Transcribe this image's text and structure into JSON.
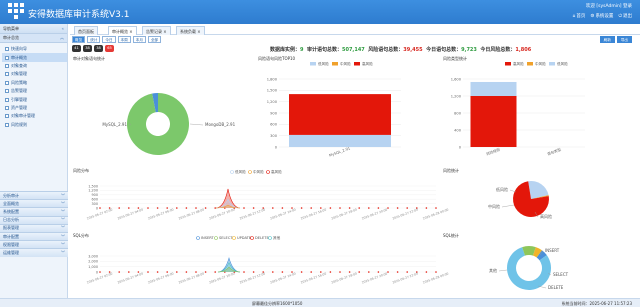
{
  "app": {
    "title": "安得数据库审计系统V3.1"
  },
  "header": {
    "welcome": "欢迎 [sysAdmin] 登录",
    "actions": [
      {
        "label": "首页",
        "icon": "home-icon"
      },
      {
        "label": "系统设置",
        "icon": "gear-icon"
      },
      {
        "label": "退出",
        "icon": "power-icon"
      }
    ]
  },
  "sidebar": {
    "head": "导航菜单",
    "sub": "审计总览",
    "items": [
      "快速向导",
      "审计概览",
      "对象查询",
      "对象管理",
      "风险策略",
      "告警管理",
      "引擎管理",
      "资产管理",
      "对象审计管理",
      "风险规则"
    ],
    "groups": [
      "分析审计",
      "全面概览",
      "系统配置",
      "日志分析",
      "报表管理",
      "审计配置",
      "权限管理",
      "运维管理"
    ]
  },
  "tabs": [
    {
      "label": "首页面板",
      "active": false
    },
    {
      "label": "审计概览",
      "active": true
    },
    {
      "label": "告警记录",
      "active": false
    },
    {
      "label": "系统负载",
      "active": false
    }
  ],
  "toolbar": {
    "buttons": [
      "概览",
      "统计",
      "今日",
      "本周",
      "本月",
      "全部"
    ],
    "right": [
      "刷新",
      "导出"
    ]
  },
  "badges": [
    "41",
    "38",
    "38",
    "65"
  ],
  "stats": {
    "prefix": "数据库实例：",
    "instances": "9",
    "audit_label": "审计语句总数：",
    "audit": "507,147",
    "risk_label": "风险语句总数：",
    "risk": "39,455",
    "today_label": "今日语句总数：",
    "today": "9,723",
    "today_risk_label": "今日风险总数：",
    "today_risk": "1,806"
  },
  "panels": {
    "p1": "审计对象语句统计",
    "p2": "风险语句风险TOP10",
    "p3": "风险类型统计",
    "p4": "风险分布",
    "p5": "风险统计",
    "p6": "SQL分布",
    "p7": "SQL统计"
  },
  "footer": {
    "center": "屏幕最佳分辨率1600*1050",
    "right": "系统当前时间：2025-06-27 11:57:23"
  },
  "chart_data": [
    {
      "type": "pie",
      "title": "审计对象语句统计",
      "labels": [
        "MySQL_2.91",
        "MongoDB_2.91"
      ],
      "values": [
        97,
        3
      ],
      "colors": [
        "#7cc86b",
        "#4a90d9"
      ]
    },
    {
      "type": "bar",
      "title": "风险语句风险TOP10",
      "legend": [
        "低风险",
        "中风险",
        "高风险"
      ],
      "categories": [
        "MySQL_2.91"
      ],
      "series": [
        {
          "name": "低风险",
          "values": [
            320
          ]
        },
        {
          "name": "中风险",
          "values": [
            0
          ]
        },
        {
          "name": "高风险",
          "values": [
            1080
          ]
        }
      ],
      "ylim": [
        0,
        1800
      ],
      "yticks": [
        "1,800",
        "1,500",
        "1,200",
        "900",
        "600",
        "300",
        "0"
      ],
      "colors": [
        "#b7d3f1",
        "#f0a12b",
        "#e3170a"
      ]
    },
    {
      "type": "bar",
      "title": "风险类型统计",
      "legend": [
        "高风险",
        "中风险",
        "低风险"
      ],
      "categories": [
        "风险规则",
        "语句类型"
      ],
      "series": [
        {
          "name": "高风险",
          "values": [
            1200,
            0
          ]
        },
        {
          "name": "中风险",
          "values": [
            0,
            0
          ]
        },
        {
          "name": "低风险",
          "values": [
            330,
            0
          ]
        }
      ],
      "ylim": [
        0,
        1600
      ],
      "yticks": [
        "1,600",
        "1,200",
        "800",
        "400",
        "0"
      ],
      "colors": [
        "#e3170a",
        "#f0a12b",
        "#b7d3f1"
      ]
    },
    {
      "type": "line",
      "title": "风险分布",
      "legend": [
        "低风险",
        "中风险",
        "高风险"
      ],
      "yticks": [
        "1,500",
        "1,200",
        "900",
        "600",
        "300",
        "0"
      ],
      "x_labels": [
        "2025-06-27 02:00",
        "2025-06-27 04:00",
        "2025-06-27 06:00",
        "2025-06-27 08:00",
        "2025-06-27 10:00",
        "2025-06-27 12:00",
        "2025-06-27 14:00",
        "2025-06-27 16:00",
        "2025-06-27 18:00",
        "2025-06-27 20:00",
        "2025-06-27 22:00",
        "2025-06-28 00:00"
      ],
      "series": [
        {
          "name": "高风险",
          "peak": 1300
        },
        {
          "name": "中风险",
          "peak": 200
        },
        {
          "name": "低风险",
          "peak": 600
        }
      ],
      "colors": [
        "#b7d3f1",
        "#f0a12b",
        "#e3170a"
      ]
    },
    {
      "type": "pie",
      "title": "风险统计",
      "labels": [
        "低风险",
        "中风险",
        "高风险"
      ],
      "values": [
        24,
        1,
        75
      ],
      "colors": [
        "#b7d3f1",
        "#f0a12b",
        "#e3170a"
      ]
    },
    {
      "type": "line",
      "title": "SQL分布",
      "legend": [
        "INSERT",
        "SELECT",
        "UPDATE",
        "DELETE",
        "其他"
      ],
      "yticks": [
        "3,000",
        "2,000",
        "1,000",
        "0"
      ],
      "x_labels": [
        "2025-06-27 02:00",
        "2025-06-27 04:00",
        "2025-06-27 06:00",
        "2025-06-27 08:00",
        "2025-06-27 10:00",
        "2025-06-27 12:00",
        "2025-06-27 14:00",
        "2025-06-27 16:00",
        "2025-06-27 18:00",
        "2025-06-27 20:00",
        "2025-06-27 22:00",
        "2025-06-28 00:00"
      ],
      "colors": [
        "#4a90d9",
        "#8ec65a",
        "#f0b429",
        "#e3170a",
        "#4ec2c8"
      ]
    },
    {
      "type": "pie",
      "title": "SQL统计",
      "labels": [
        "INSERT",
        "其他",
        "SELECT",
        "DELETE"
      ],
      "values": [
        5,
        80,
        10,
        5
      ],
      "colors": [
        "#4a90d9",
        "#6fc3e8",
        "#8ec65a",
        "#f0b429"
      ]
    }
  ]
}
